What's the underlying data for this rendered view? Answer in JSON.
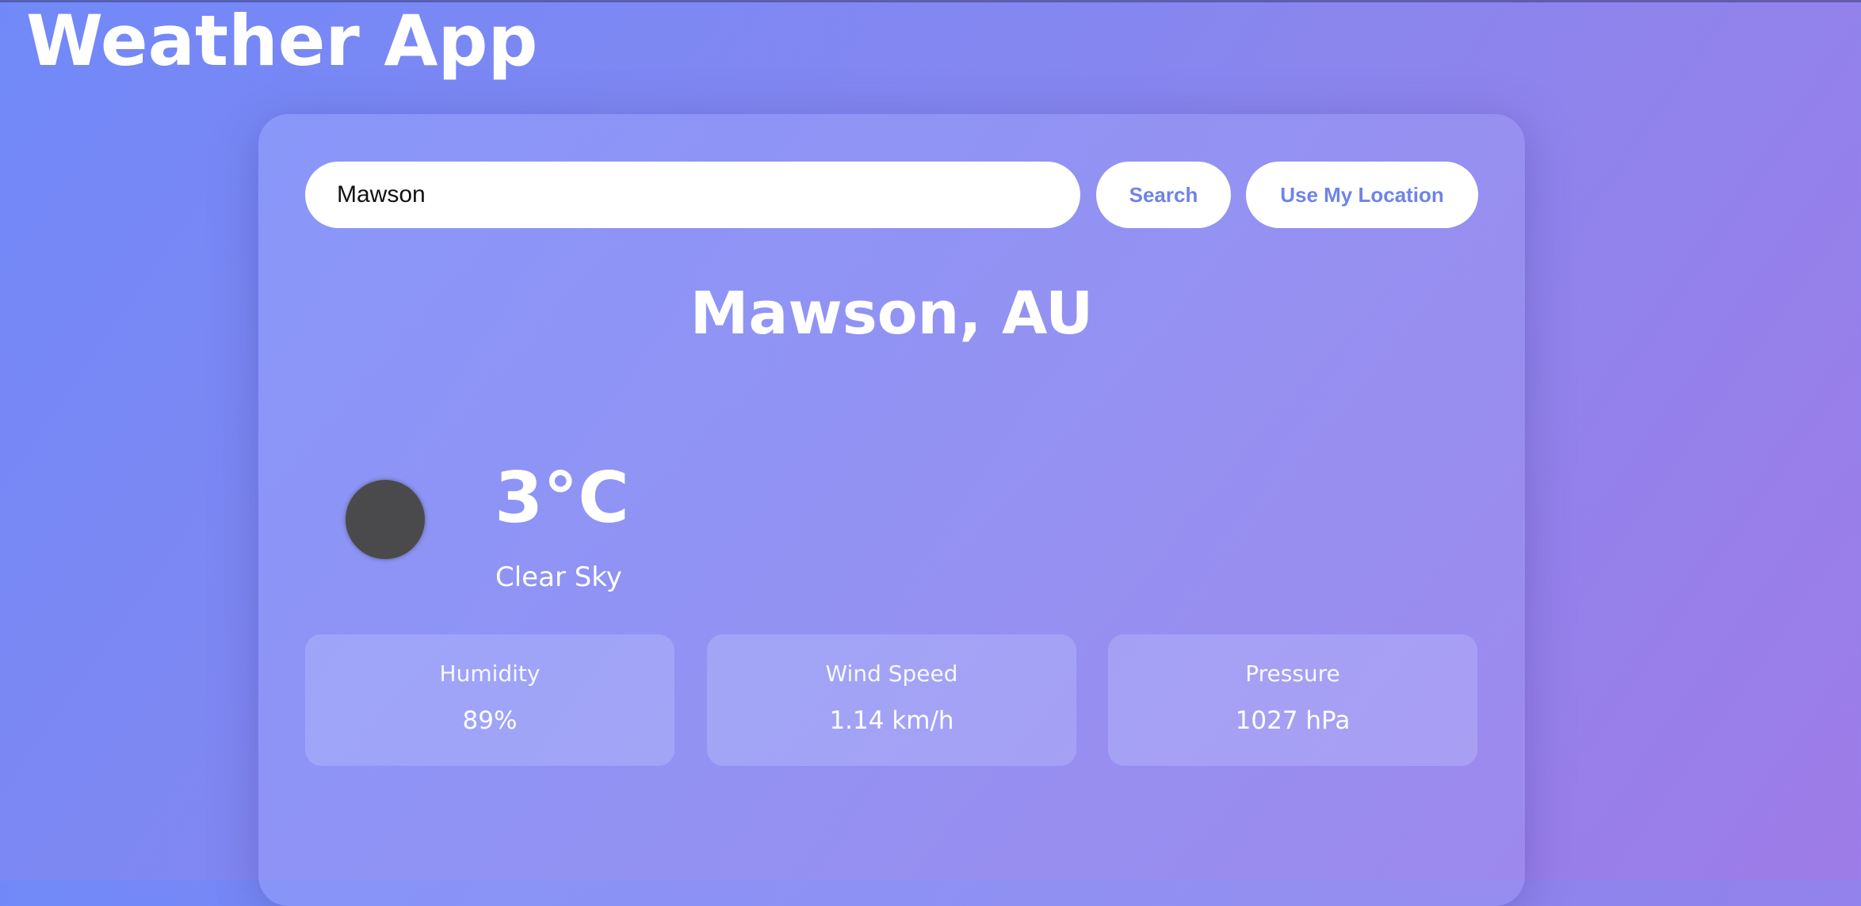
{
  "header": {
    "title": "Weather App"
  },
  "search": {
    "value": "Mawson",
    "search_label": "Search",
    "location_label": "Use My Location"
  },
  "weather": {
    "location": "Mawson, AU",
    "temperature": "3°C",
    "condition": "Clear Sky",
    "icon": "weather-condition-icon"
  },
  "stats": [
    {
      "label": "Humidity",
      "value": "89%"
    },
    {
      "label": "Wind Speed",
      "value": "1.14 km/h"
    },
    {
      "label": "Pressure",
      "value": "1027 hPa"
    }
  ],
  "colors": {
    "accent": "#6f83e8",
    "icon_fill": "#4a4a4c",
    "background_start": "#7189f8",
    "background_end": "#9e7ce8"
  }
}
